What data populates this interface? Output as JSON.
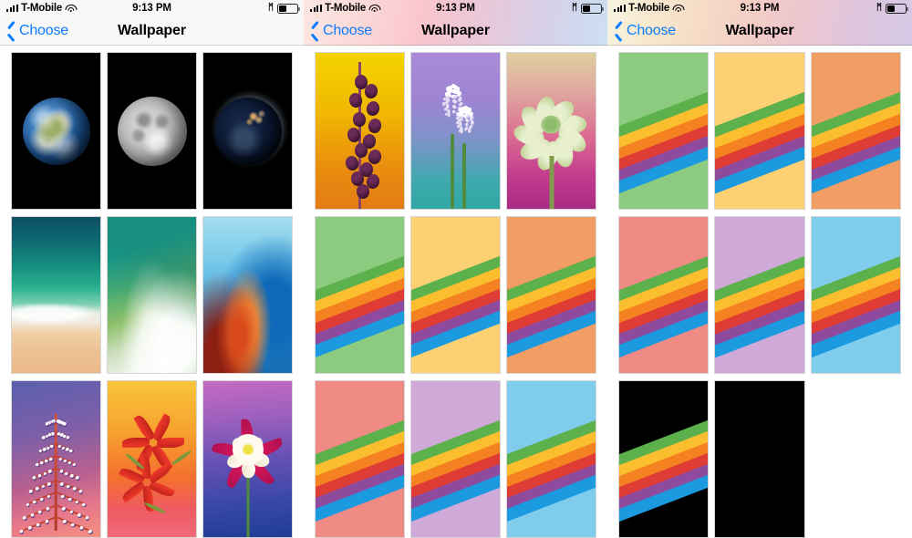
{
  "screens": [
    {
      "id": "screen-1",
      "statusbar": {
        "carrier": "T-Mobile",
        "time": "9:13 PM",
        "bluetooth_icon": "bluetooth-icon",
        "battery_icon": "battery-icon",
        "wifi_icon": "wifi-icon",
        "signal_icon": "signal-bars-icon"
      },
      "nav": {
        "back_label": "Choose",
        "back_icon": "chevron-left-icon",
        "title": "Wallpaper"
      },
      "navbar_style": "plain",
      "thumbnails": [
        {
          "name": "wallpaper-earth-day",
          "kind": "earth-day"
        },
        {
          "name": "wallpaper-moon",
          "kind": "moon"
        },
        {
          "name": "wallpaper-earth-night",
          "kind": "earth-night"
        },
        {
          "name": "wallpaper-beach-aerial",
          "kind": "beach"
        },
        {
          "name": "wallpaper-ocean-wave",
          "kind": "wave"
        },
        {
          "name": "wallpaper-abstract-blue-orange",
          "kind": "abstract"
        },
        {
          "name": "wallpaper-flower-purple-spike",
          "kind": "flower-spike"
        },
        {
          "name": "wallpaper-flower-gloriosa-orange",
          "kind": "flower-gloriosa"
        },
        {
          "name": "wallpaper-flower-columbine-blue",
          "kind": "flower-columbine"
        }
      ]
    },
    {
      "id": "screen-2",
      "statusbar": {
        "carrier": "T-Mobile",
        "time": "9:13 PM",
        "bluetooth_icon": "bluetooth-icon",
        "battery_icon": "battery-icon",
        "wifi_icon": "wifi-icon",
        "signal_icon": "signal-bars-icon"
      },
      "nav": {
        "back_label": "Choose",
        "back_icon": "chevron-left-icon",
        "title": "Wallpaper"
      },
      "navbar_style": "gradient-pink-blue",
      "thumbnails": [
        {
          "name": "wallpaper-fritillaria-yellow",
          "kind": "flower-fritillaria"
        },
        {
          "name": "wallpaper-muscari-purple",
          "kind": "flower-muscari"
        },
        {
          "name": "wallpaper-hellebore-magenta",
          "kind": "flower-hellebore"
        },
        {
          "name": "wallpaper-stripes-green",
          "kind": "stripes",
          "bg": "#8ccb80"
        },
        {
          "name": "wallpaper-stripes-yellow",
          "kind": "stripes",
          "bg": "#fdd073"
        },
        {
          "name": "wallpaper-stripes-orange",
          "kind": "stripes",
          "bg": "#f29d63"
        },
        {
          "name": "wallpaper-stripes-pink",
          "kind": "stripes",
          "bg": "#ef8a85"
        },
        {
          "name": "wallpaper-stripes-lavender",
          "kind": "stripes",
          "bg": "#cfa9d8"
        },
        {
          "name": "wallpaper-stripes-lightblue",
          "kind": "stripes",
          "bg": "#7fcced"
        }
      ]
    },
    {
      "id": "screen-3",
      "statusbar": {
        "carrier": "T-Mobile",
        "time": "9:13 PM",
        "bluetooth_icon": "bluetooth-icon",
        "battery_icon": "battery-icon",
        "wifi_icon": "wifi-icon",
        "signal_icon": "signal-bars-icon"
      },
      "nav": {
        "back_label": "Choose",
        "back_icon": "chevron-left-icon",
        "title": "Wallpaper"
      },
      "navbar_style": "gradient-cream-lavender",
      "thumbnails": [
        {
          "name": "wallpaper-stripes-green",
          "kind": "stripes",
          "bg": "#8ccb80"
        },
        {
          "name": "wallpaper-stripes-yellow",
          "kind": "stripes",
          "bg": "#fdd073"
        },
        {
          "name": "wallpaper-stripes-orange",
          "kind": "stripes",
          "bg": "#f29d63"
        },
        {
          "name": "wallpaper-stripes-pink",
          "kind": "stripes",
          "bg": "#ef8a85"
        },
        {
          "name": "wallpaper-stripes-lavender",
          "kind": "stripes",
          "bg": "#cfa9d8"
        },
        {
          "name": "wallpaper-stripes-lightblue",
          "kind": "stripes",
          "bg": "#7fcced"
        },
        {
          "name": "wallpaper-stripes-black",
          "kind": "stripes",
          "bg": "#000000"
        },
        {
          "name": "wallpaper-solid-black",
          "kind": "solid",
          "bg": "#000000"
        }
      ]
    }
  ],
  "stripe_colors": [
    "#5cb14c",
    "#fbbe2e",
    "#f58220",
    "#e03c36",
    "#8e4b9e",
    "#1b9ae0"
  ],
  "theme": {
    "accent_blue": "#0a7cff",
    "navbar_bg": "#f8f8f8",
    "thumb_border": "#d6d6d6",
    "page_bg": "#ffffff"
  }
}
